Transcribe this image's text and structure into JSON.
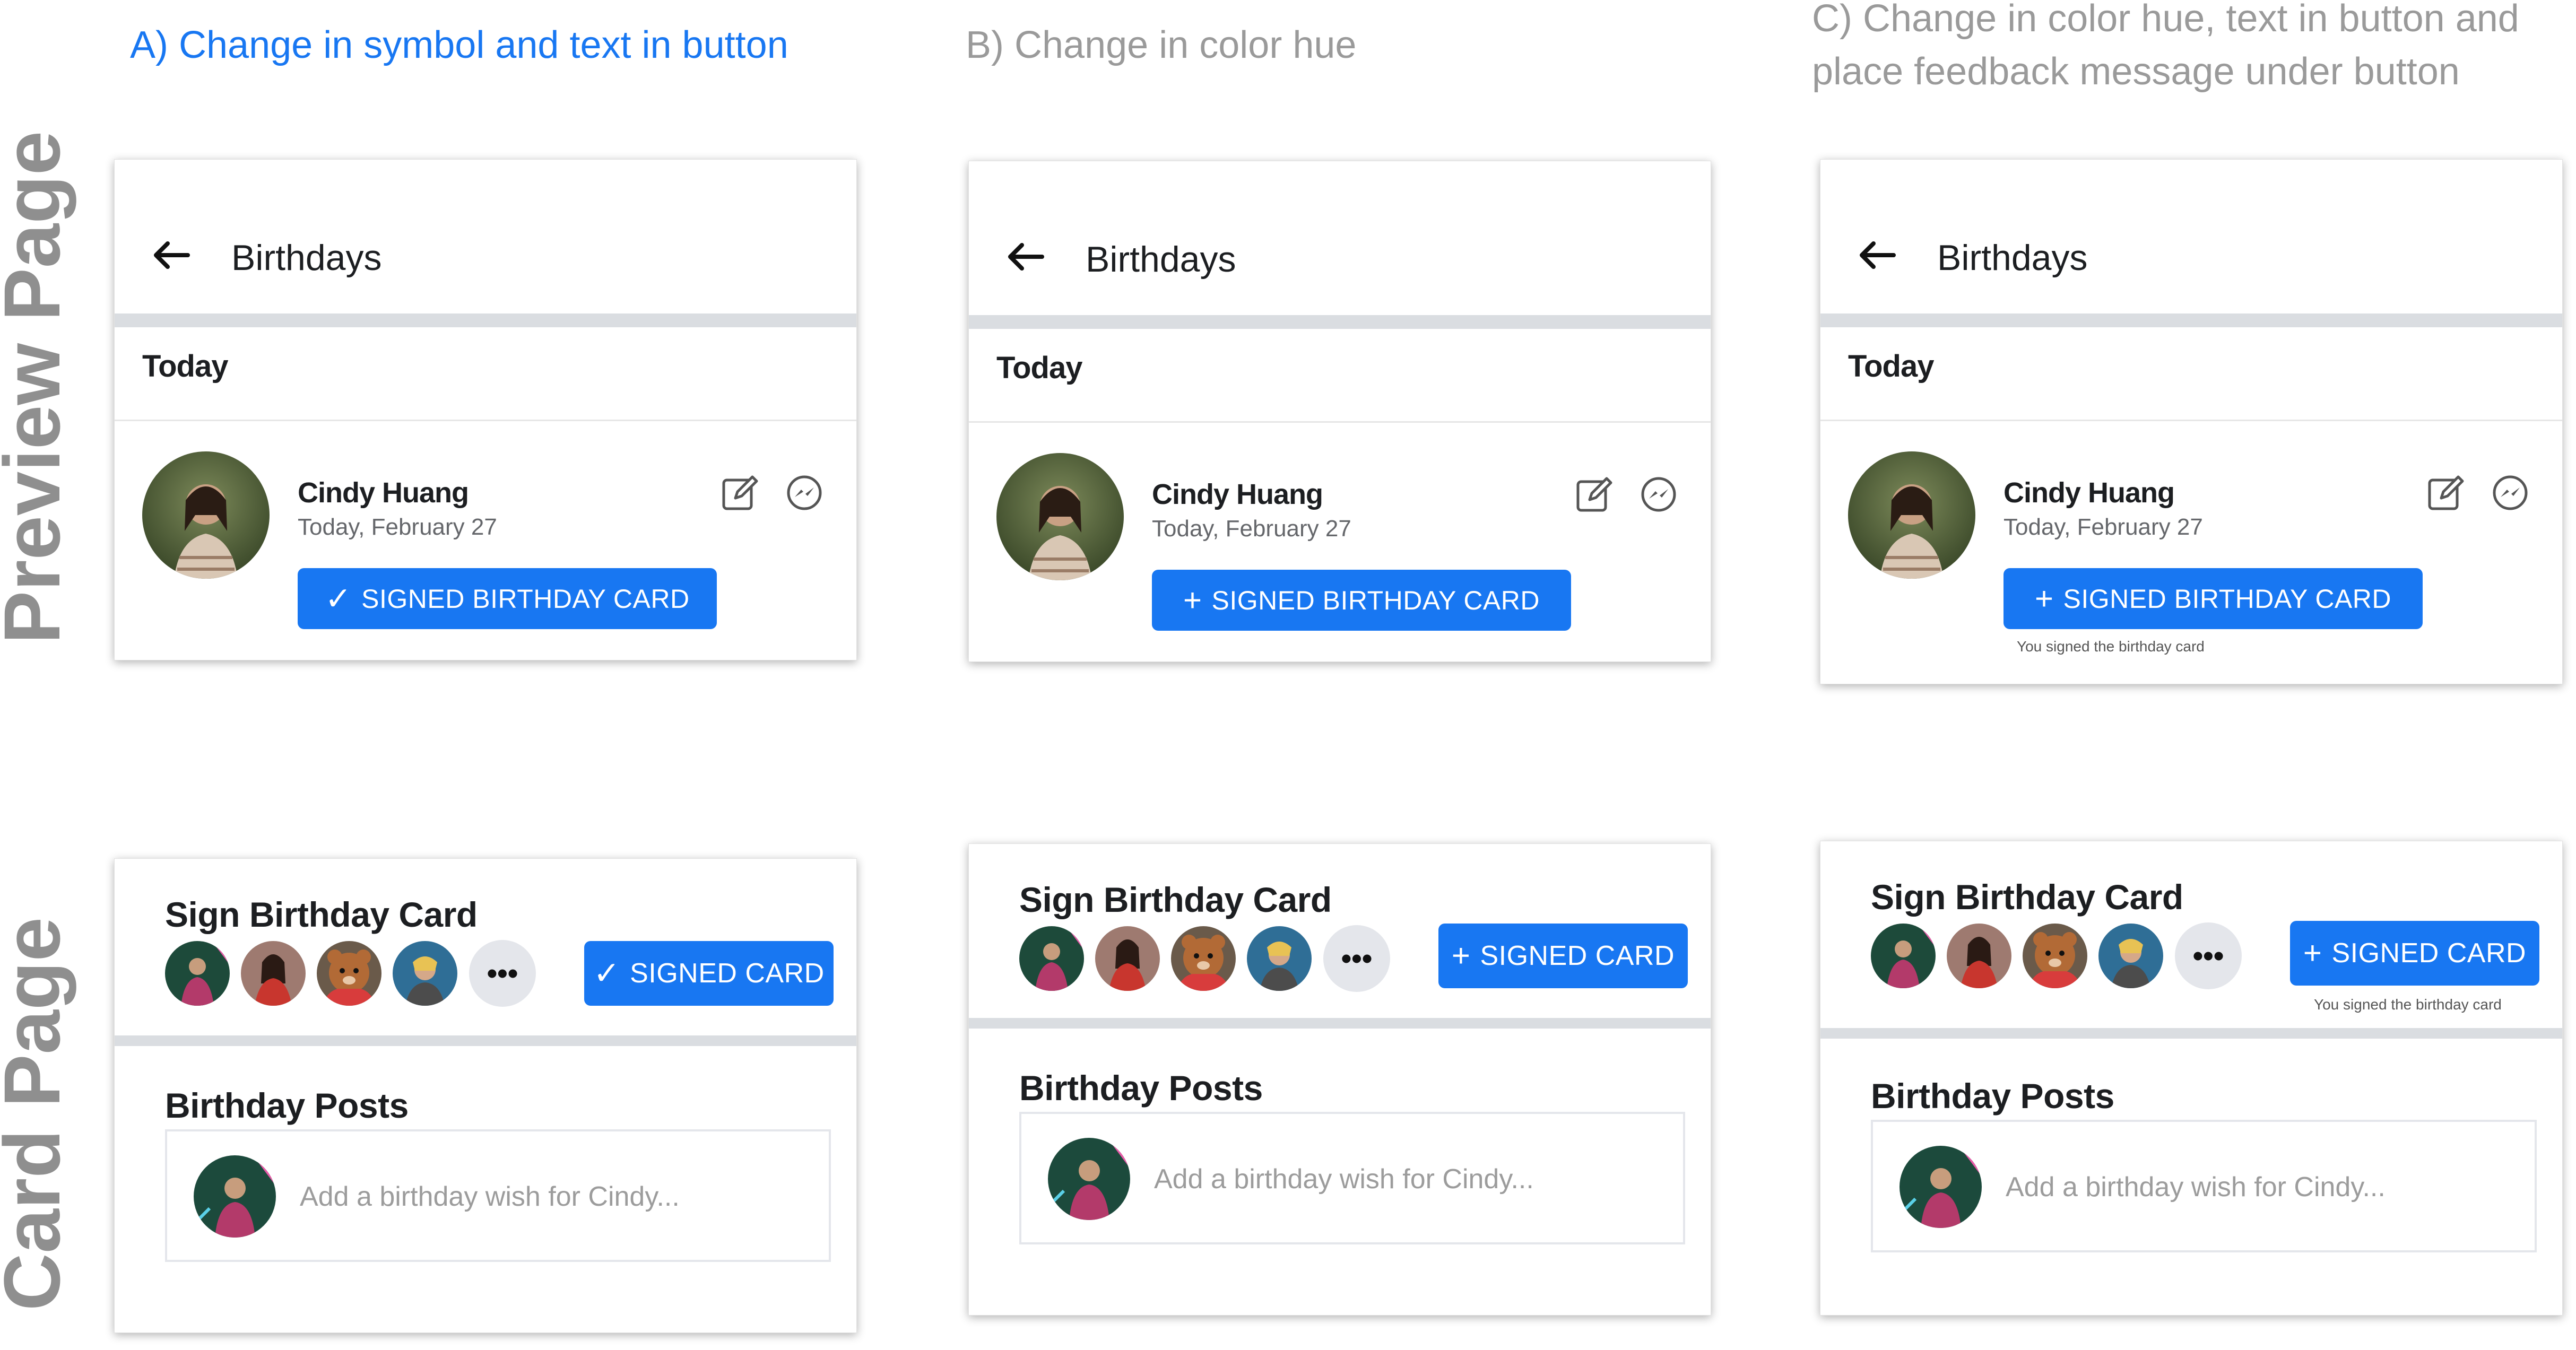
{
  "row_labels": {
    "preview": "Preview Page",
    "card": "Card Page"
  },
  "columns": [
    {
      "title": "A) Change in symbol and text in button",
      "preview": {
        "header": "Birthdays",
        "section": "Today",
        "name": "Cindy Huang",
        "date": "Today, February 27",
        "button_glyph": "✓",
        "button_label": "SIGNED BIRTHDAY CARD",
        "feedback": ""
      },
      "card": {
        "title": "Sign Birthday Card",
        "more": "•••",
        "button_glyph": "✓",
        "button_label": "SIGNED CARD",
        "feedback": "",
        "posts_title": "Birthday Posts",
        "wish_placeholder": "Add a birthday wish for Cindy..."
      }
    },
    {
      "title": "B) Change in color hue",
      "preview": {
        "header": "Birthdays",
        "section": "Today",
        "name": "Cindy Huang",
        "date": "Today, February 27",
        "button_glyph": "+",
        "button_label": "SIGNED BIRTHDAY CARD",
        "feedback": ""
      },
      "card": {
        "title": "Sign Birthday Card",
        "more": "•••",
        "button_glyph": "+",
        "button_label": "SIGNED CARD",
        "feedback": "",
        "posts_title": "Birthday Posts",
        "wish_placeholder": "Add a birthday wish for Cindy..."
      }
    },
    {
      "title": "C) Change in color hue, text in button and place feedback message under button",
      "preview": {
        "header": "Birthdays",
        "section": "Today",
        "name": "Cindy Huang",
        "date": "Today, February 27",
        "button_glyph": "+",
        "button_label": "SIGNED BIRTHDAY CARD",
        "feedback": "You signed the birthday card"
      },
      "card": {
        "title": "Sign Birthday Card",
        "more": "•••",
        "button_glyph": "+",
        "button_label": "SIGNED CARD",
        "feedback": "You signed the birthday card",
        "posts_title": "Birthday Posts",
        "wish_placeholder": "Add a birthday wish for Cindy..."
      }
    }
  ],
  "colors": {
    "accent": "#1877f2",
    "title_inactive": "#9a9a9a",
    "row_label": "#8f8f8f"
  },
  "icons": [
    "back-arrow-icon",
    "edit-icon",
    "messenger-icon",
    "checkmark-icon",
    "plus-icon",
    "more-icon"
  ]
}
